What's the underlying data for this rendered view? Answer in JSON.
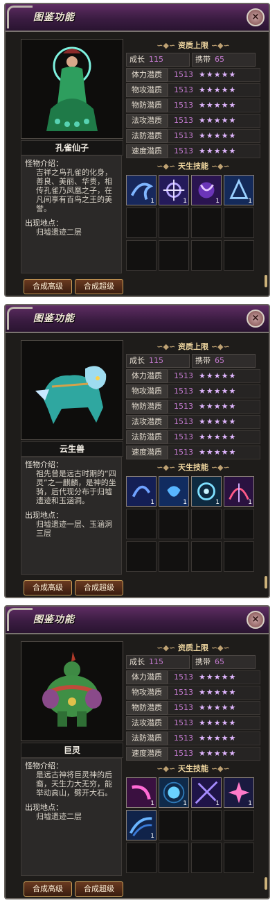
{
  "colors": {
    "title_bar": "#3b1c42",
    "value_purple": "#c57bd1",
    "stars": "#e0b6ff",
    "button_border": "#cda25b"
  },
  "panels": [
    {
      "title": "图鉴功能",
      "close_label": "×",
      "monster_name": "孔雀仙子",
      "intro_label": "怪物介绍：",
      "intro_text": "吉祥之鸟孔雀的化身，善良、美丽、华贵，相传孔雀乃凤凰之子，在凡间享有百鸟之王的美誉。",
      "location_label": "出现地点：",
      "location_text": "归墟遗迹二层",
      "btn_high": "合成高级",
      "btn_super": "合成超级",
      "quality_header": "资质上限",
      "growth_label": "成长",
      "growth_value": "115",
      "carry_label": "携带",
      "carry_value": "65",
      "stats": [
        {
          "label": "体力潜质",
          "value": "1513",
          "stars": "★★★★★"
        },
        {
          "label": "物攻潜质",
          "value": "1513",
          "stars": "★★★★★"
        },
        {
          "label": "物防潜质",
          "value": "1513",
          "stars": "★★★★★"
        },
        {
          "label": "法攻潜质",
          "value": "1513",
          "stars": "★★★★★"
        },
        {
          "label": "法防潜质",
          "value": "1513",
          "stars": "★★★★★"
        },
        {
          "label": "速度潜质",
          "value": "1513",
          "stars": "★★★★★"
        }
      ],
      "skills_header": "天生技能",
      "skill_count": 4,
      "skill_levels": [
        "1",
        "1",
        "1",
        "1"
      ]
    },
    {
      "title": "图鉴功能",
      "close_label": "×",
      "monster_name": "云生兽",
      "intro_label": "怪物介绍：",
      "intro_text": "祖先曾是远古时期的“四灵”之一麒麟，是神的坐骑，后代现分布于归墟遗迹和玉涵洞。",
      "location_label": "出现地点：",
      "location_text": "归墟遗迹一层、玉涵洞三层",
      "btn_high": "合成高级",
      "btn_super": "合成超级",
      "quality_header": "资质上限",
      "growth_label": "成长",
      "growth_value": "115",
      "carry_label": "携带",
      "carry_value": "65",
      "stats": [
        {
          "label": "体力潜质",
          "value": "1513",
          "stars": "★★★★★"
        },
        {
          "label": "物攻潜质",
          "value": "1513",
          "stars": "★★★★★"
        },
        {
          "label": "物防潜质",
          "value": "1513",
          "stars": "★★★★★"
        },
        {
          "label": "法攻潜质",
          "value": "1513",
          "stars": "★★★★★"
        },
        {
          "label": "法防潜质",
          "value": "1513",
          "stars": "★★★★★"
        },
        {
          "label": "速度潜质",
          "value": "1513",
          "stars": "★★★★★"
        }
      ],
      "skills_header": "天生技能",
      "skill_count": 4,
      "skill_levels": [
        "1",
        "1",
        "1",
        "1"
      ]
    },
    {
      "title": "图鉴功能",
      "close_label": "×",
      "monster_name": "巨灵",
      "intro_label": "怪物介绍：",
      "intro_text": "是远古神将巨灵神的后裔，天生力大无穷，能举动高山，劈开大石。",
      "location_label": "出现地点：",
      "location_text": "归墟遗迹二层",
      "btn_high": "合成高级",
      "btn_super": "合成超级",
      "quality_header": "资质上限",
      "growth_label": "成长",
      "growth_value": "115",
      "carry_label": "携带",
      "carry_value": "65",
      "stats": [
        {
          "label": "体力潜质",
          "value": "1513",
          "stars": "★★★★★"
        },
        {
          "label": "物攻潜质",
          "value": "1513",
          "stars": "★★★★★"
        },
        {
          "label": "物防潜质",
          "value": "1513",
          "stars": "★★★★★"
        },
        {
          "label": "法攻潜质",
          "value": "1513",
          "stars": "★★★★★"
        },
        {
          "label": "法防潜质",
          "value": "1513",
          "stars": "★★★★★"
        },
        {
          "label": "速度潜质",
          "value": "1513",
          "stars": "★★★★★"
        }
      ],
      "skills_header": "天生技能",
      "skill_count": 5,
      "skill_levels": [
        "1",
        "1",
        "1",
        "1",
        "1"
      ]
    }
  ]
}
